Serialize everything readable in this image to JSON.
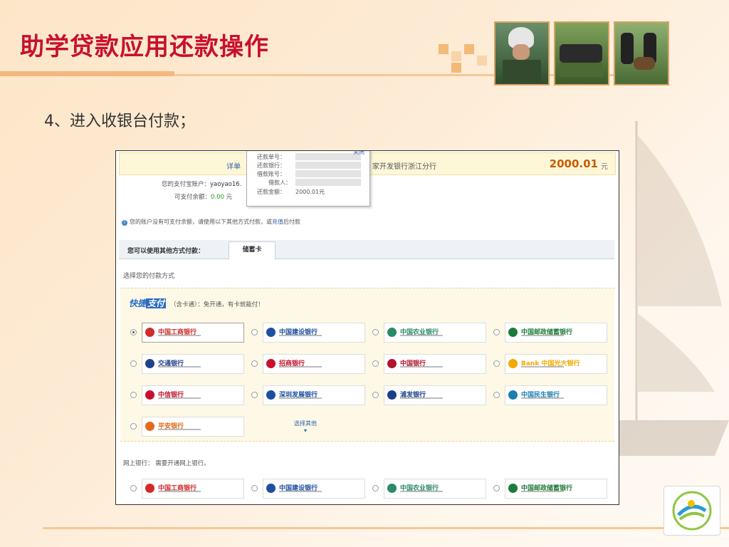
{
  "slide": {
    "title": "助学贷款应用还款操作",
    "step": "4、进入收银台付款；",
    "photo_captions": [
      "",
      "",
      ""
    ]
  },
  "cashier": {
    "detail_link": "详单",
    "branch_text": "家开发银行浙江分行",
    "amount": "2000.01",
    "amount_unit": "元",
    "close_link": "关闭",
    "popup": {
      "rows": [
        {
          "label": "还款单号：",
          "value": ""
        },
        {
          "label": "还款银行：",
          "value": ""
        },
        {
          "label": "借款账号：",
          "value": ""
        },
        {
          "label": "借款人：",
          "value": ""
        },
        {
          "label": "还款金额：",
          "value": "2000.01元"
        }
      ]
    },
    "account_label": "您的支付宝账户：",
    "account_value": "yaoyao16.",
    "balance_label": "可支付余额：",
    "balance_value": "0.00",
    "balance_unit": "元",
    "notice_prefix": "您的账户没有可支付余额，请使用以下其他方式付款，或",
    "notice_link": "充值",
    "notice_suffix": "后付款",
    "tabs_label": "您可以使用其他方式付款：",
    "tab_debit": "储蓄卡",
    "choose_method": "选择您的付款方式",
    "quick_pay_a": "快捷",
    "quick_pay_b": "支付",
    "quick_pay_sub": "（含卡通）：免开通，有卡就能付！",
    "more_banks": "选择其他",
    "online_banking": "网上银行：  需要开通网上银行。",
    "quick_banks": [
      {
        "name": "中国工商银行",
        "color": "#d22a2a",
        "selected": true
      },
      {
        "name": "中国建设银行",
        "color": "#1f4fa0",
        "selected": false
      },
      {
        "name": "中国农业银行",
        "color": "#2a8a6a",
        "selected": false
      },
      {
        "name": "中国邮政储蓄银行",
        "color": "#1e7a3a",
        "selected": false
      },
      {
        "name": "交通银行",
        "color": "#22418c",
        "selected": false
      },
      {
        "name": "招商银行",
        "color": "#c8102e",
        "selected": false
      },
      {
        "name": "中国银行",
        "color": "#b0152a",
        "selected": false
      },
      {
        "name": "Bank 中国光大银行",
        "color": "#f2a900",
        "selected": false
      },
      {
        "name": "中信银行",
        "color": "#c8102e",
        "selected": false
      },
      {
        "name": "深圳发展银行",
        "color": "#1a4fa0",
        "selected": false
      },
      {
        "name": "浦发银行",
        "color": "#1a3f8a",
        "selected": false
      },
      {
        "name": "中国民生银行",
        "color": "#1a7fb0",
        "selected": false
      },
      {
        "name": "平安银行",
        "color": "#e36b1c",
        "selected": false
      }
    ],
    "online_banks": [
      {
        "name": "中国工商银行",
        "color": "#d22a2a"
      },
      {
        "name": "中国建设银行",
        "color": "#1f4fa0"
      },
      {
        "name": "中国农业银行",
        "color": "#2a8a6a"
      },
      {
        "name": "中国邮政储蓄银行",
        "color": "#1e7a3a"
      }
    ]
  }
}
